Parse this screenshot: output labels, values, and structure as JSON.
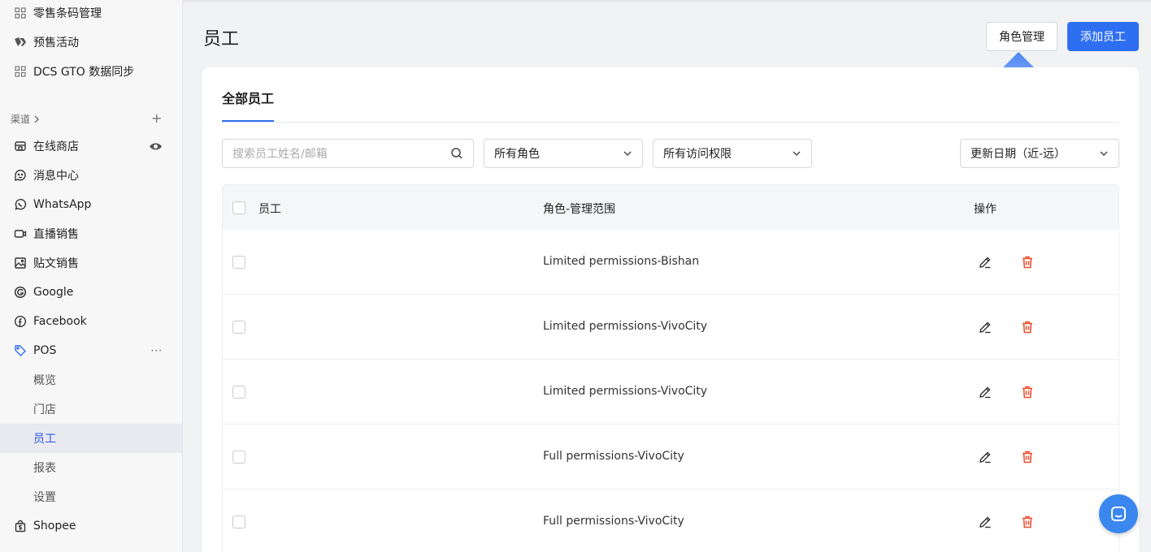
{
  "sidebar": {
    "items": [
      {
        "label": "零售条码管理",
        "icon": "grid-icon"
      },
      {
        "label": "预售活动",
        "icon": "tags-icon"
      },
      {
        "label": "DCS GTO 数据同步",
        "icon": "grid-icon"
      }
    ],
    "section": {
      "label": "渠道",
      "chevron": "chevron-right-icon",
      "add": "+"
    },
    "channels": [
      {
        "label": "在线商店",
        "icon": "store-icon"
      },
      {
        "label": "消息中心",
        "icon": "chat-smile-icon"
      },
      {
        "label": "WhatsApp",
        "icon": "whatsapp-icon"
      },
      {
        "label": "直播销售",
        "icon": "video-icon"
      },
      {
        "label": "贴文销售",
        "icon": "image-icon"
      },
      {
        "label": "Google",
        "icon": "google-icon"
      },
      {
        "label": "Facebook",
        "icon": "facebook-icon"
      },
      {
        "label": "POS",
        "icon": "tag-icon",
        "more": "···"
      }
    ],
    "pos_sub": [
      {
        "label": "概览",
        "active": false
      },
      {
        "label": "门店",
        "active": false
      },
      {
        "label": "员工",
        "active": true
      },
      {
        "label": "报表",
        "active": false
      },
      {
        "label": "设置",
        "active": false
      }
    ],
    "shopee": {
      "label": "Shopee",
      "icon": "shopping-bag-icon"
    }
  },
  "header": {
    "title": "员工",
    "role_button": "角色管理",
    "add_button": "添加员工"
  },
  "card": {
    "tab": "全部员工",
    "filters": {
      "search_placeholder": "搜索员工姓名/邮箱",
      "role_select": "所有角色",
      "access_select": "所有访问权限",
      "sort_select": "更新日期（近-远）"
    },
    "table": {
      "columns": {
        "employee": "员工",
        "role_scope": "角色-管理范围",
        "actions": "操作"
      },
      "rows": [
        {
          "role": "Limited permissions-Bishan"
        },
        {
          "role": "Limited permissions-VivoCity"
        },
        {
          "role": "Limited permissions-VivoCity"
        },
        {
          "role": "Full permissions-VivoCity"
        },
        {
          "role": "Full permissions-VivoCity"
        }
      ]
    }
  },
  "colors": {
    "accent": "#2e6ff2",
    "danger": "#ef4a2a",
    "arrow": "#5b8ff5"
  }
}
